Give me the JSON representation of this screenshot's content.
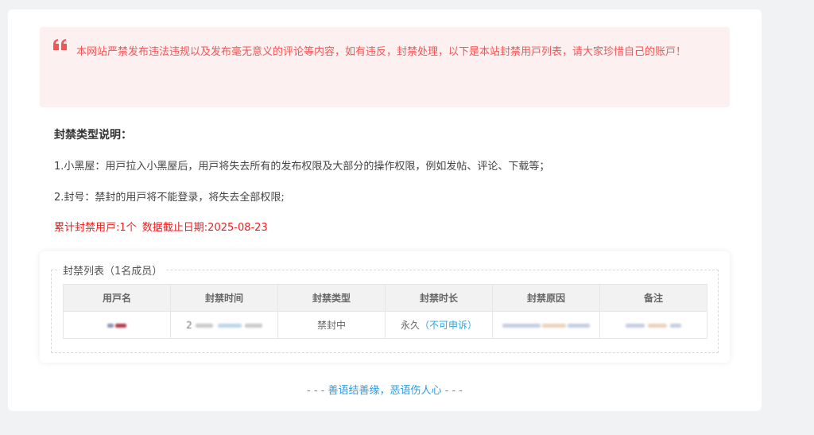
{
  "notice": {
    "icon": "quote-icon",
    "text": "本网站严禁发布违法违规以及发布毫无意义的评论等内容，如有违反，封禁处理，以下是本站封禁用戸列表，请大家珍惜自己的账戸！"
  },
  "ban_types": {
    "title": "封禁类型说明：",
    "items": [
      "1.小黑屋：用戸拉入小黑屋后，用戸将失去所有的发布权限及大部分的操作权限，例如发帖、评论、下载等；",
      "2.封号：禁封的用戸将不能登录，将失去全部权限;"
    ]
  },
  "stats": {
    "total_label": "累计封禁用戸:1个",
    "deadline_label": "数据截止日期:2025-08-23"
  },
  "ban_list": {
    "legend": "封禁列表（1名成员）",
    "columns": [
      "用戸名",
      "封禁时间",
      "封禁类型",
      "封禁时长",
      "封禁原因",
      "备注"
    ],
    "rows": [
      {
        "username": "",
        "ban_time": "2",
        "ban_type": "禁封中",
        "duration": "永久",
        "appeal": "（不可申诉）",
        "reason": "",
        "remark": ""
      }
    ]
  },
  "footer": {
    "motto": "- - - 善语结善缘，恶语伤人心 - - -"
  },
  "colors": {
    "notice_bg": "#fdf0f0",
    "notice_text": "#f25555",
    "stats_text": "#f01c1c",
    "link_blue": "#2aa7e0"
  }
}
